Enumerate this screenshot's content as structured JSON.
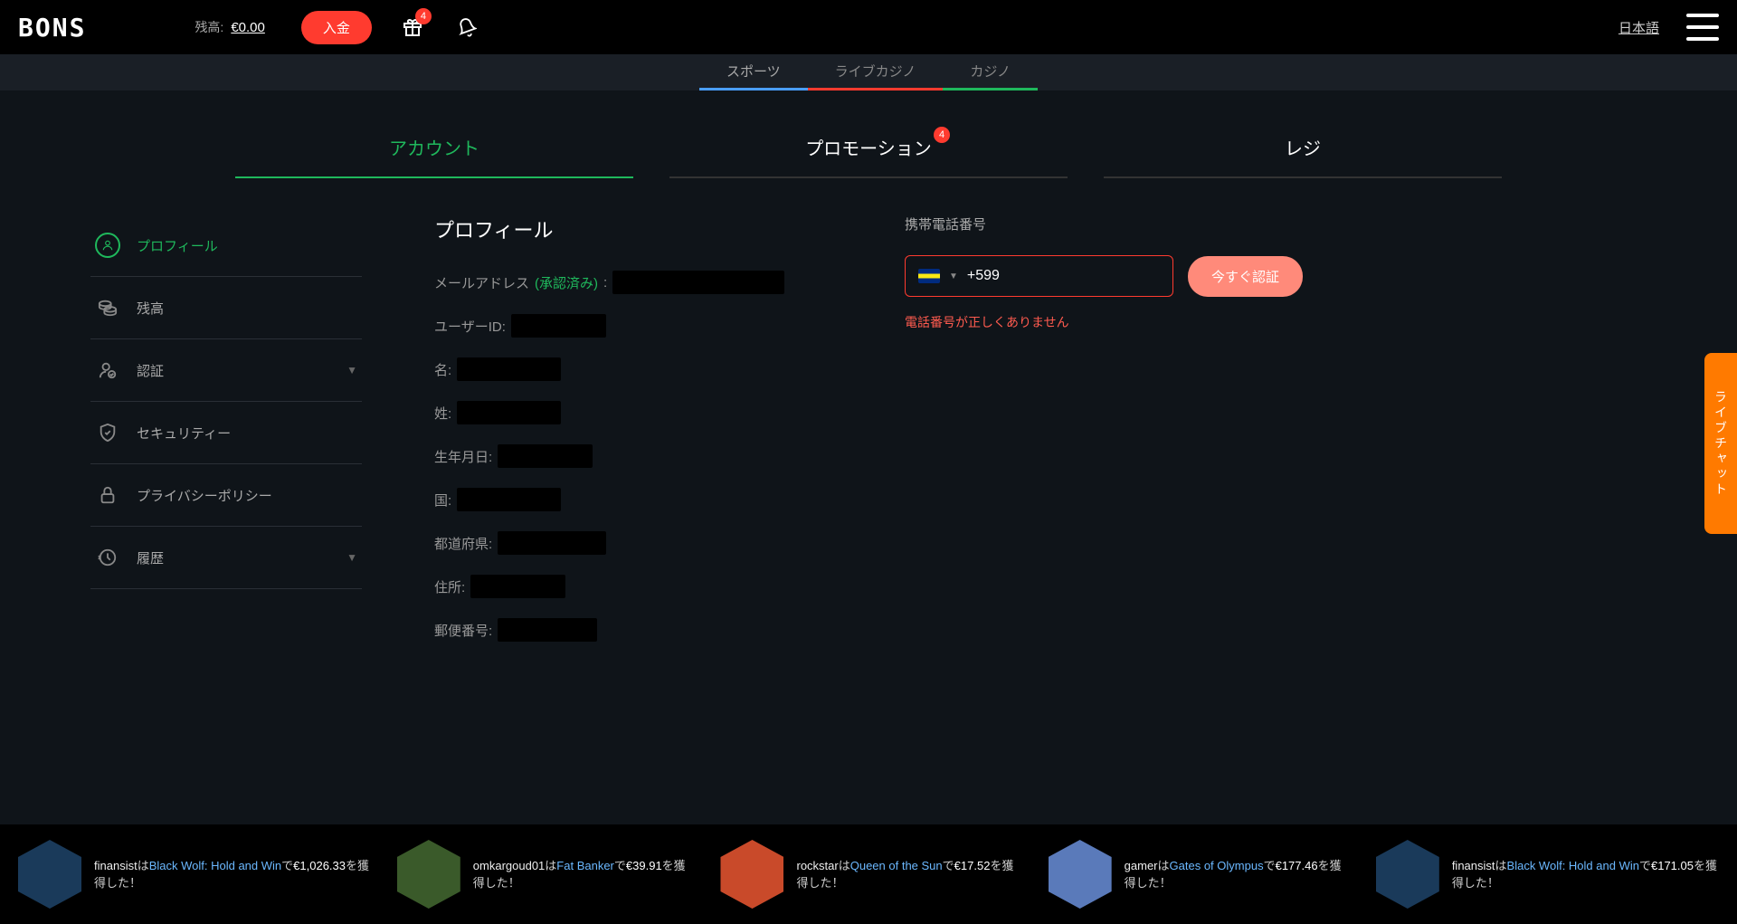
{
  "header": {
    "logo": "BONS",
    "balance_label": "残高:",
    "balance_value": "€0.00",
    "deposit": "入金",
    "gift_badge": "4",
    "language": "日本語"
  },
  "nav": {
    "sports": "スポーツ",
    "live_casino": "ライブカジノ",
    "casino": "カジノ"
  },
  "main_tabs": {
    "account": "アカウント",
    "promotion": "プロモーション",
    "promotion_badge": "4",
    "cashier": "レジ"
  },
  "sidebar": {
    "profile": "プロフィール",
    "balance": "残高",
    "verification": "認証",
    "security": "セキュリティー",
    "privacy": "プライバシーポリシー",
    "history": "履歴"
  },
  "profile": {
    "title": "プロフィール",
    "email_label": "メールアドレス",
    "email_verified": "(承認済み)",
    "email_colon": ":",
    "userid_label": "ユーザーID:",
    "firstname_label": "名:",
    "lastname_label": "姓:",
    "dob_label": "生年月日:",
    "country_label": "国:",
    "state_label": "都道府県:",
    "address_label": "住所:",
    "postal_label": "郵便番号:"
  },
  "phone": {
    "label": "携帯電話番号",
    "prefix": "+599",
    "verify_btn": "今すぐ認証",
    "error": "電話番号が正しくありません"
  },
  "livechat": "ライブチャット",
  "ticker": [
    {
      "user": "finansist",
      "game": "Black Wolf: Hold and Win",
      "amount": "€1,026.33",
      "verb": "は",
      "de": "で",
      "suffix": "を獲得した！"
    },
    {
      "user": "omkargoud01",
      "game": "Fat Banker",
      "amount": "€39.91",
      "verb": "は",
      "de": "で",
      "suffix": "を獲得した！"
    },
    {
      "user": "rockstar",
      "game": "Queen of the Sun",
      "amount": "€17.52",
      "verb": "は",
      "de": "で",
      "suffix": "を獲得した！"
    },
    {
      "user": "gamer",
      "game": "Gates of Olympus",
      "amount": "€177.46",
      "verb": "は",
      "de": "で",
      "suffix": "を獲得した！"
    },
    {
      "user": "finansist",
      "game": "Black Wolf: Hold and Win",
      "amount": "€171.05",
      "verb": "は",
      "de": "で",
      "suffix": "を獲得した！"
    }
  ]
}
